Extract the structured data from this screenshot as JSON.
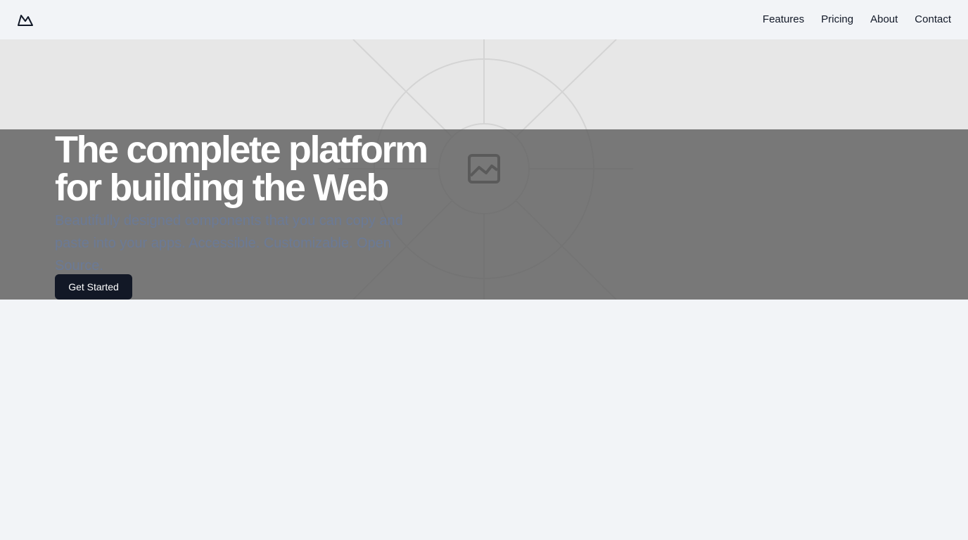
{
  "header": {
    "logo_icon": "mountain-logo-icon",
    "nav": [
      {
        "label": "Features"
      },
      {
        "label": "Pricing"
      },
      {
        "label": "About"
      },
      {
        "label": "Contact"
      }
    ]
  },
  "hero": {
    "title_line1": "The complete platform",
    "title_line2": "for building the Web",
    "subtitle": "Beautifully designed components that you can copy and paste into your apps. Accessible. Customizable. Open Source.",
    "cta_label": "Get Started",
    "image_icon": "image-placeholder-icon"
  },
  "colors": {
    "background": "#f2f4f7",
    "overlay": "#777777",
    "cta_bg": "#121826",
    "title": "#ffffff",
    "subtitle": "#6b7a96"
  }
}
